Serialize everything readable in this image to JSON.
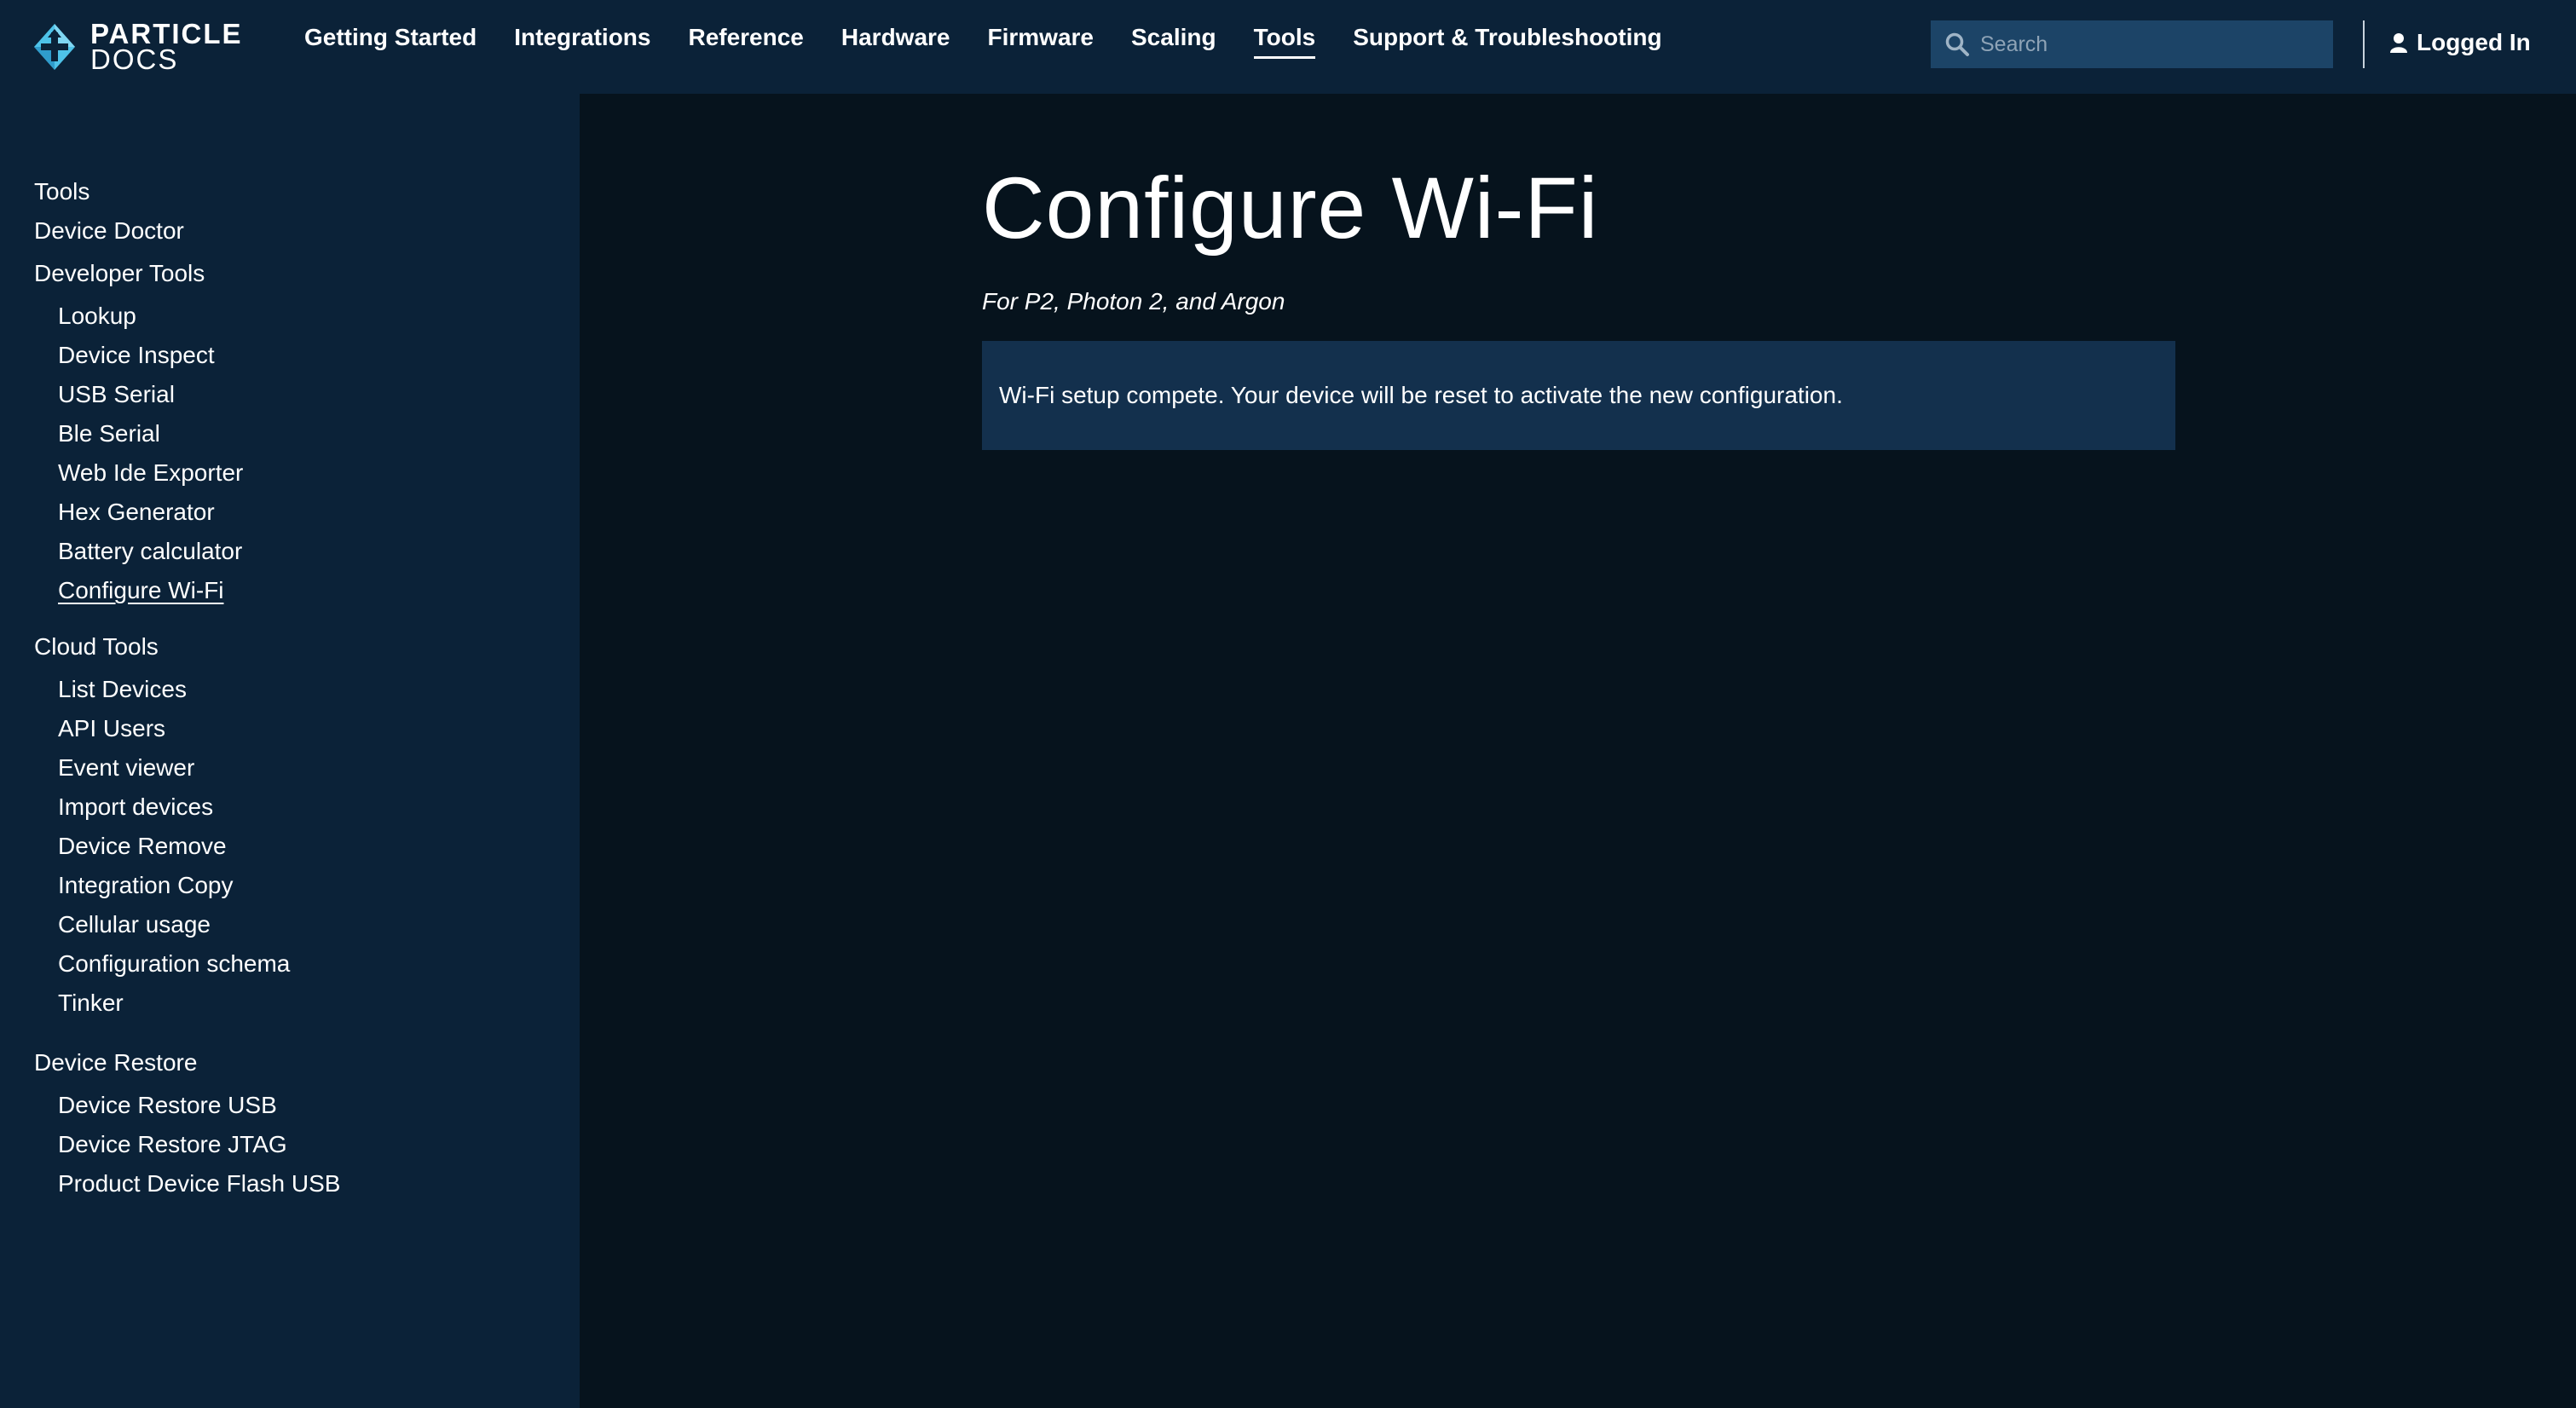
{
  "header": {
    "logo": {
      "line1": "PARTICLE",
      "line2": "DOCS"
    },
    "nav": [
      {
        "label": "Getting Started",
        "active": false
      },
      {
        "label": "Integrations",
        "active": false
      },
      {
        "label": "Reference",
        "active": false
      },
      {
        "label": "Hardware",
        "active": false
      },
      {
        "label": "Firmware",
        "active": false
      },
      {
        "label": "Scaling",
        "active": false
      },
      {
        "label": "Tools",
        "active": true
      },
      {
        "label": "Support & Troubleshooting",
        "active": false
      }
    ],
    "search": {
      "placeholder": "Search",
      "value": ""
    },
    "user": {
      "label": "Logged In",
      "icon": "user-icon"
    }
  },
  "sidebar": {
    "top_items": [
      "Tools",
      "Device Doctor"
    ],
    "groups": [
      {
        "title": "Developer Tools",
        "items": [
          "Lookup",
          "Device Inspect",
          "USB Serial",
          "Ble Serial",
          "Web Ide Exporter",
          "Hex Generator",
          "Battery calculator",
          "Configure Wi-Fi"
        ]
      },
      {
        "title": "Cloud Tools",
        "items": [
          "List Devices",
          "API Users",
          "Event viewer",
          "Import devices",
          "Device Remove",
          "Integration Copy",
          "Cellular usage",
          "Configuration schema",
          "Tinker"
        ]
      },
      {
        "title": "Device Restore",
        "items": [
          "Device Restore USB",
          "Device Restore JTAG",
          "Product Device Flash USB"
        ]
      }
    ],
    "current_item": "Configure Wi-Fi"
  },
  "main": {
    "title": "Configure Wi-Fi",
    "subtitle": "For P2, Photon 2, and Argon",
    "notice": "Wi-Fi setup compete. Your device will be reset to activate the new configuration."
  },
  "colors": {
    "header_bg": "#0b2238",
    "sidebar_bg": "#0b2238",
    "page_bg": "#06131d",
    "notice_bg": "#13304d",
    "search_bg": "#1c4467",
    "logo_accent": "#4ec2e8"
  }
}
